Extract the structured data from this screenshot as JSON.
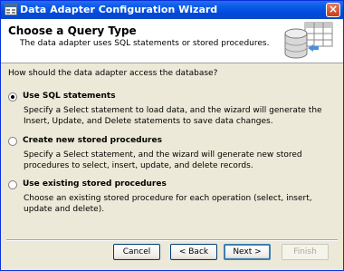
{
  "window": {
    "title": "Data Adapter Configuration Wizard"
  },
  "header": {
    "title": "Choose a Query Type",
    "subtitle": "The data adapter uses SQL statements or stored procedures."
  },
  "question": "How should the data adapter access the database?",
  "options": [
    {
      "label": "Use SQL statements",
      "selected": true,
      "description": "Specify a Select statement to load data, and the wizard will generate the Insert, Update, and Delete statements to save data changes."
    },
    {
      "label": "Create new stored procedures",
      "selected": false,
      "description": "Specify a Select statement, and the wizard will generate new stored procedures to select, insert, update, and delete records."
    },
    {
      "label": "Use existing stored procedures",
      "selected": false,
      "description": "Choose an existing stored procedure for each operation (select, insert, update and delete)."
    }
  ],
  "buttons": {
    "cancel": "Cancel",
    "back": "< Back",
    "next": "Next >",
    "finish": "Finish"
  },
  "icons": {
    "app": "app-icon",
    "close": "close-icon",
    "header_graphic": "database-table-icon"
  }
}
